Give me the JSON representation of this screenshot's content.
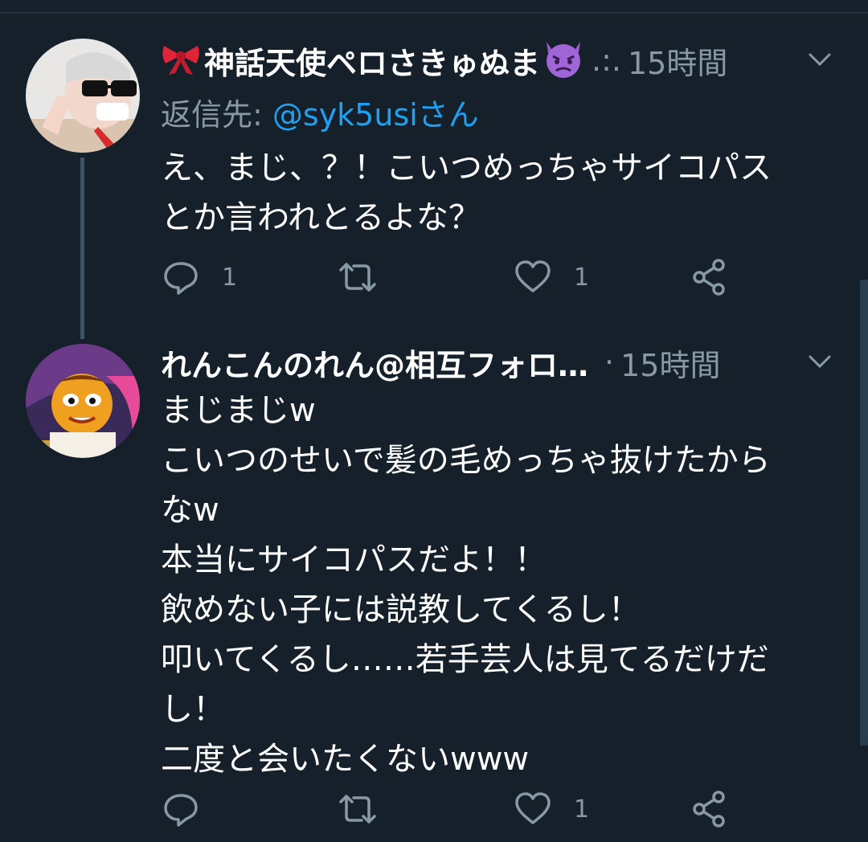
{
  "colors": {
    "background": "#15202b",
    "secondary_text": "#8899a6",
    "link": "#1da1f2",
    "thread_line": "#3d5466"
  },
  "tweets": [
    {
      "display_name": "神話天使ペロさきゅぬま",
      "name_prefix_emoji": "ribbon-emoji",
      "name_suffix_emoji": "angry-devil-emoji",
      "dots": ".:.",
      "time": "15時間",
      "reply_label": "返信先: ",
      "reply_mention": "@syk5usiさん",
      "text": "え、まじ、？！こいつめっちゃサイコパス\nとか言われとるよな？",
      "actions": {
        "reply_count": "1",
        "retweet_count": "",
        "like_count": "1"
      }
    },
    {
      "display_name": "れんこんのれん@相互フォロ…",
      "dots": "·",
      "time": "15時間",
      "text": "まじまじw\nこいつのせいで髪の毛めっちゃ抜けたから\nなw\n本当にサイコパスだよ！！\n飲めない子には説教してくるし！\n叩いてくるし……若手芸人は見てるだけだ\nし！\n二度と会いたくないwww",
      "actions": {
        "reply_count": "",
        "retweet_count": "",
        "like_count": "1"
      }
    }
  ],
  "icons": [
    "reply-icon",
    "retweet-icon",
    "like-icon",
    "share-icon",
    "chevron-down-icon"
  ]
}
